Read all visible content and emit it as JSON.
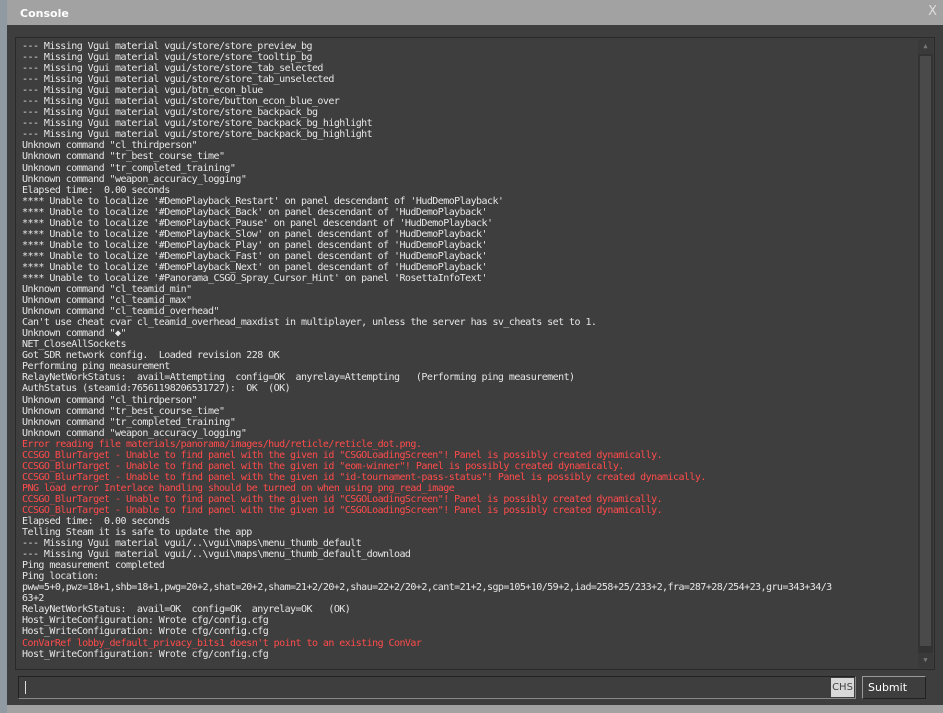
{
  "window": {
    "title": "Console",
    "close_label": "X"
  },
  "lines": [
    {
      "t": "--- Missing Vgui material vgui/store/store_preview_bg",
      "e": false
    },
    {
      "t": "--- Missing Vgui material vgui/store/store_tooltip_bg",
      "e": false
    },
    {
      "t": "--- Missing Vgui material vgui/store/store_tab_selected",
      "e": false
    },
    {
      "t": "--- Missing Vgui material vgui/store/store_tab_unselected",
      "e": false
    },
    {
      "t": "--- Missing Vgui material vgui/btn_econ_blue",
      "e": false
    },
    {
      "t": "--- Missing Vgui material vgui/store/button_econ_blue_over",
      "e": false
    },
    {
      "t": "--- Missing Vgui material vgui/store/store_backpack_bg",
      "e": false
    },
    {
      "t": "--- Missing Vgui material vgui/store/store_backpack_bg_highlight",
      "e": false
    },
    {
      "t": "--- Missing Vgui material vgui/store/store_backpack_bg_highlight",
      "e": false
    },
    {
      "t": "Unknown command \"cl_thirdperson\"",
      "e": false
    },
    {
      "t": "Unknown command \"tr_best_course_time\"",
      "e": false
    },
    {
      "t": "Unknown command \"tr_completed_training\"",
      "e": false
    },
    {
      "t": "Unknown command \"weapon_accuracy_logging\"",
      "e": false
    },
    {
      "t": "Elapsed time:  0.00 seconds",
      "e": false
    },
    {
      "t": "**** Unable to localize '#DemoPlayback_Restart' on panel descendant of 'HudDemoPlayback'",
      "e": false
    },
    {
      "t": "**** Unable to localize '#DemoPlayback_Back' on panel descendant of 'HudDemoPlayback'",
      "e": false
    },
    {
      "t": "**** Unable to localize '#DemoPlayback_Pause' on panel descendant of 'HudDemoPlayback'",
      "e": false
    },
    {
      "t": "**** Unable to localize '#DemoPlayback_Slow' on panel descendant of 'HudDemoPlayback'",
      "e": false
    },
    {
      "t": "**** Unable to localize '#DemoPlayback_Play' on panel descendant of 'HudDemoPlayback'",
      "e": false
    },
    {
      "t": "**** Unable to localize '#DemoPlayback_Fast' on panel descendant of 'HudDemoPlayback'",
      "e": false
    },
    {
      "t": "**** Unable to localize '#DemoPlayback_Next' on panel descendant of 'HudDemoPlayback'",
      "e": false
    },
    {
      "t": "**** Unable to localize '#Panorama_CSGO_Spray_Cursor_Hint' on panel 'RosettaInfoText'",
      "e": false
    },
    {
      "t": "Unknown command \"cl_teamid_min\"",
      "e": false
    },
    {
      "t": "Unknown command \"cl_teamid_max\"",
      "e": false
    },
    {
      "t": "Unknown command \"cl_teamid_overhead\"",
      "e": false
    },
    {
      "t": "Can't use cheat cvar cl_teamid_overhead_maxdist in multiplayer, unless the server has sv_cheats set to 1.",
      "e": false
    },
    {
      "t": "Unknown command \"◆\"",
      "e": false
    },
    {
      "t": "NET_CloseAllSockets",
      "e": false
    },
    {
      "t": "Got SDR network config.  Loaded revision 228 OK",
      "e": false
    },
    {
      "t": "Performing ping measurement",
      "e": false
    },
    {
      "t": "RelayNetWorkStatus:  avail=Attempting  config=OK  anyrelay=Attempting   (Performing ping measurement)",
      "e": false
    },
    {
      "t": "AuthStatus (steamid:76561198206531727):  OK  (OK)",
      "e": false
    },
    {
      "t": "Unknown command \"cl_thirdperson\"",
      "e": false
    },
    {
      "t": "Unknown command \"tr_best_course_time\"",
      "e": false
    },
    {
      "t": "Unknown command \"tr_completed_training\"",
      "e": false
    },
    {
      "t": "Unknown command \"weapon_accuracy_logging\"",
      "e": false
    },
    {
      "t": "Error reading file materials/panorama/images/hud/reticle/reticle_dot.png.",
      "e": true
    },
    {
      "t": "CCSGO_BlurTarget - Unable to find panel with the given id \"CSGOLoadingScreen\"! Panel is possibly created dynamically.",
      "e": true
    },
    {
      "t": "CCSGO_BlurTarget - Unable to find panel with the given id \"eom-winner\"! Panel is possibly created dynamically.",
      "e": true
    },
    {
      "t": "CCSGO_BlurTarget - Unable to find panel with the given id \"id-tournament-pass-status\"! Panel is possibly created dynamically.",
      "e": true
    },
    {
      "t": "PNG load error Interlace handling should be turned on when using png_read_image",
      "e": true
    },
    {
      "t": "CCSGO_BlurTarget - Unable to find panel with the given id \"CSGOLoadingScreen\"! Panel is possibly created dynamically.",
      "e": true
    },
    {
      "t": "CCSGO_BlurTarget - Unable to find panel with the given id \"CSGOLoadingScreen\"! Panel is possibly created dynamically.",
      "e": true
    },
    {
      "t": "Elapsed time:  0.00 seconds",
      "e": false
    },
    {
      "t": "Telling Steam it is safe to update the app",
      "e": false
    },
    {
      "t": "--- Missing Vgui material vgui/..\\vgui\\maps\\menu_thumb_default",
      "e": false
    },
    {
      "t": "--- Missing Vgui material vgui/..\\vgui\\maps\\menu_thumb_default_download",
      "e": false
    },
    {
      "t": "Ping measurement completed",
      "e": false
    },
    {
      "t": "Ping location:",
      "e": false
    },
    {
      "t": "pww=5+0,pwz=18+1,shb=18+1,pwg=20+2,shat=20+2,sham=21+2/20+2,shau=22+2/20+2,cant=21+2,sgp=105+10/59+2,iad=258+25/233+2,fra=287+28/254+23,gru=343+34/3",
      "e": false
    },
    {
      "t": "63+2",
      "e": false
    },
    {
      "t": "RelayNetWorkStatus:  avail=OK  config=OK  anyrelay=OK   (OK)",
      "e": false
    },
    {
      "t": "Host_WriteConfiguration: Wrote cfg/config.cfg",
      "e": false
    },
    {
      "t": "Host_WriteConfiguration: Wrote cfg/config.cfg",
      "e": false
    },
    {
      "t": "ConVarRef lobby_default_privacy_bits1 doesn't point to an existing ConVar",
      "e": true
    },
    {
      "t": "Host_WriteConfiguration: Wrote cfg/config.cfg",
      "e": false
    }
  ],
  "input": {
    "value": "",
    "ime_label": "CHS"
  },
  "submit_label": "Submit",
  "colors": {
    "text": "#e6e6e6",
    "error": "#ff4b4b",
    "background": "#3e3e3e"
  }
}
